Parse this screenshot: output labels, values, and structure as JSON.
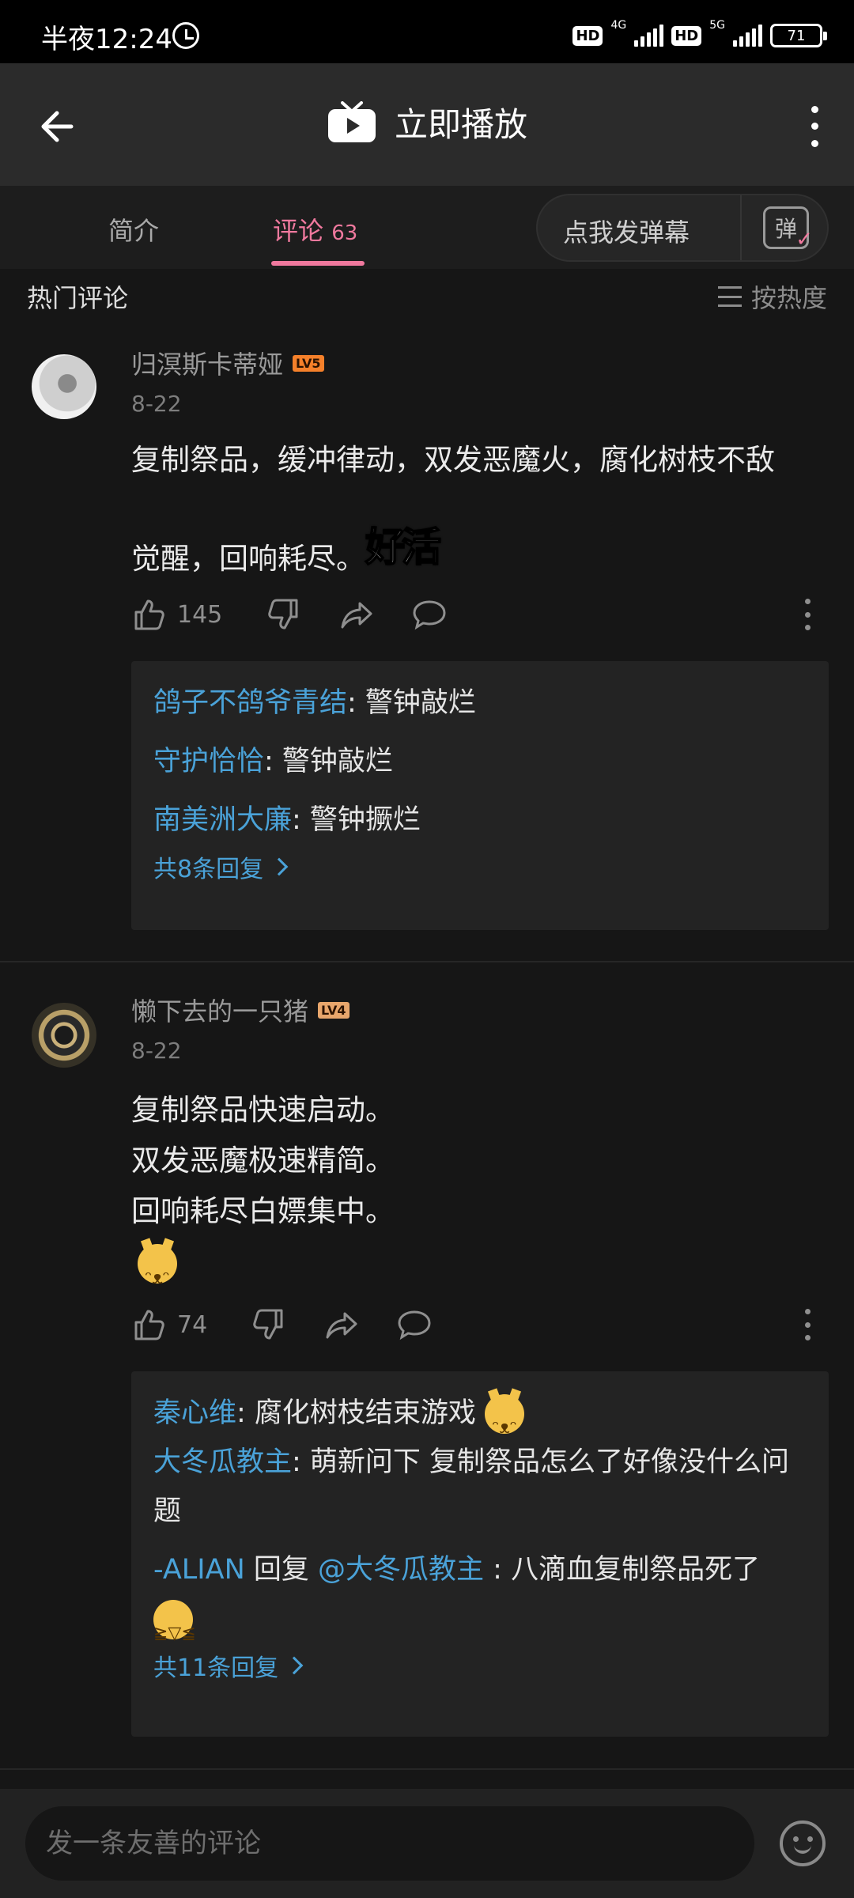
{
  "status_bar": {
    "time": "半夜12:24",
    "hd1": "HD",
    "net1": "4G",
    "hd2": "HD",
    "net2": "5G",
    "battery": "71"
  },
  "header": {
    "title": "立即播放"
  },
  "tabs": [
    {
      "label": "简介"
    },
    {
      "label": "评论",
      "count": "63"
    }
  ],
  "danmu": {
    "label": "点我发弹幕",
    "icon_char": "弹"
  },
  "section": {
    "title": "热门评论",
    "sort_label": "按热度"
  },
  "comments": [
    {
      "user": "归溟斯卡蒂娅",
      "level": "LV5",
      "date": "8-22",
      "text_lines": [
        "复制祭品，缓冲律动，双发恶魔火，腐化树枝不敌",
        "觉醒，回响耗尽。"
      ],
      "sticker": "好活",
      "likes": "145",
      "replies": [
        {
          "user": "鸽子不鸽爷青结",
          "text": ": 警钟敲烂"
        },
        {
          "user": "守护恰恰",
          "text": ": 警钟敲烂"
        },
        {
          "user": "南美洲大廉",
          "text": ": 警钟撅烂"
        }
      ],
      "reply_total": "共8条回复"
    },
    {
      "user": "懒下去的一只猪",
      "level": "LV4",
      "date": "8-22",
      "text_lines": [
        "复制祭品快速启动。",
        "双发恶魔极速精简。",
        "回响耗尽白嫖集中。"
      ],
      "likes": "74",
      "replies": [
        {
          "user": "秦心维",
          "text": ": 腐化树枝结束游戏"
        },
        {
          "user": "大冬瓜教主",
          "text": ": 萌新问下 复制祭品怎么了好像没什么问题"
        },
        {
          "user": "-ALIAN",
          "mid": " 回复 ",
          "mention": "@大冬瓜教主",
          "text": " : 八滴血复制祭品死了"
        }
      ],
      "reply_total": "共11条回复"
    }
  ],
  "composer": {
    "placeholder": "发一条友善的评论"
  },
  "colors": {
    "accent_pink": "#f0799e",
    "link_blue": "#4aa2d8",
    "background": "#161616"
  }
}
